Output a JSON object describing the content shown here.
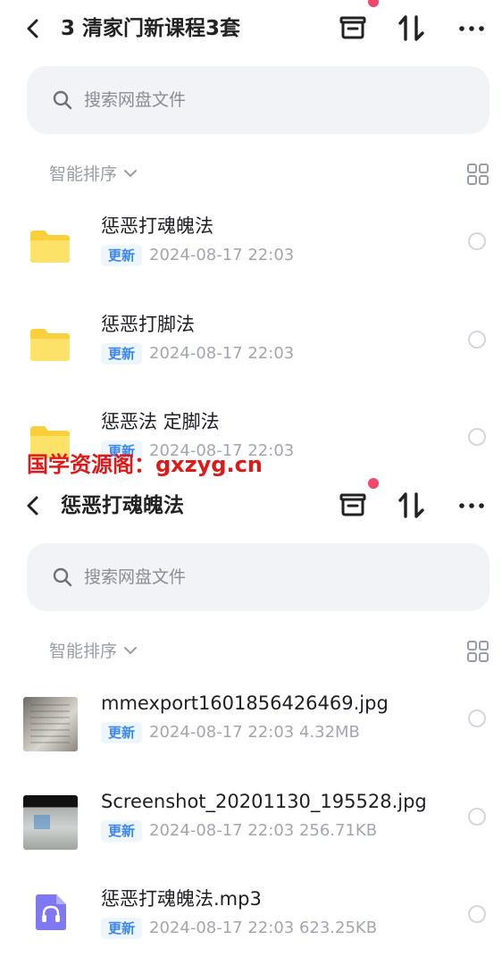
{
  "colors": {
    "accent_blue": "#3b86f5",
    "badge_bg": "#edf5ff",
    "folder_yellow": "#f9cf3b",
    "notification_red": "#f0476a",
    "watermark_red": "#e01818",
    "audio_purple": "#7f78f2"
  },
  "screens": [
    {
      "title": "3 清家门新课程3套",
      "search_placeholder": "搜索网盘文件",
      "sort_label": "智能排序",
      "icons": [
        "back-arrow-icon",
        "box-icon",
        "sort-arrows-icon",
        "more-dots-icon",
        "search-icon",
        "chevron-down-icon",
        "grid-view-icon"
      ],
      "items": [
        {
          "name": "惩恶打魂魄法",
          "badge": "更新",
          "meta": "2024-08-17  22:03",
          "type": "folder"
        },
        {
          "name": "惩恶打脚法",
          "badge": "更新",
          "meta": "2024-08-17  22:03",
          "type": "folder"
        },
        {
          "name": "惩恶法 定脚法",
          "badge": "更新",
          "meta": "2024-08-17  22:03",
          "type": "folder"
        }
      ]
    },
    {
      "title": "惩恶打魂魄法",
      "search_placeholder": "搜索网盘文件",
      "sort_label": "智能排序",
      "icons": [
        "back-arrow-icon",
        "box-icon",
        "sort-arrows-icon",
        "more-dots-icon",
        "search-icon",
        "chevron-down-icon",
        "grid-view-icon"
      ],
      "items": [
        {
          "name": "mmexport1601856426469.jpg",
          "badge": "更新",
          "meta": "2024-08-17  22:03   4.32MB",
          "type": "image"
        },
        {
          "name": "Screenshot_20201130_195528.jpg",
          "badge": "更新",
          "meta": "2024-08-17  22:03   256.71KB",
          "type": "image"
        },
        {
          "name": "惩恶打魂魄法.mp3",
          "badge": "更新",
          "meta": "2024-08-17  22:03   623.25KB",
          "type": "audio"
        }
      ]
    }
  ],
  "watermark": "国学资源阁：gxzyg.cn"
}
